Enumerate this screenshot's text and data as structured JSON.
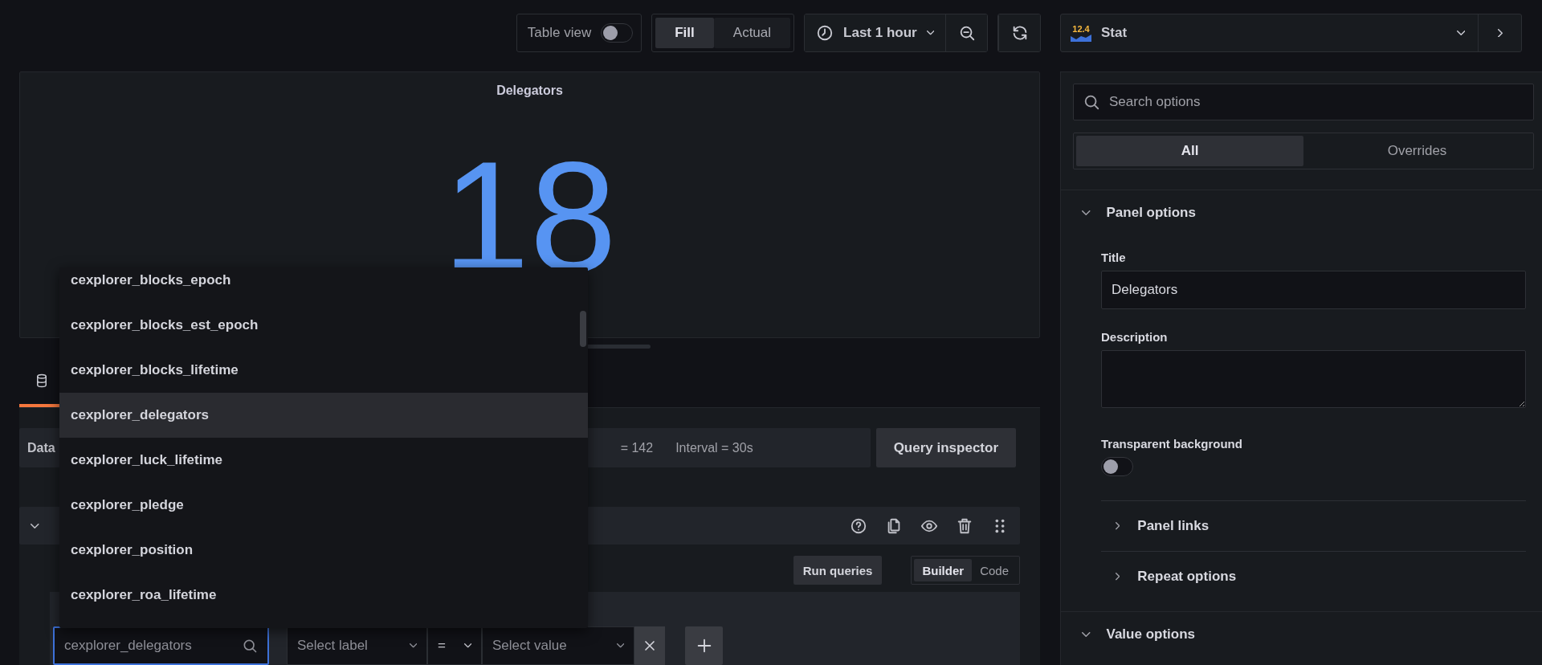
{
  "toolbar": {
    "table_view": {
      "label": "Table view",
      "on": false
    },
    "fill_modes": [
      {
        "label": "Fill",
        "selected": true
      },
      {
        "label": "Actual",
        "selected": false
      }
    ],
    "time_range": "Last 1 hour"
  },
  "visualization": {
    "icon_text": "12.4",
    "name": "Stat"
  },
  "panel": {
    "title": "Delegators",
    "value": "18"
  },
  "query_tab": {
    "selected": true
  },
  "query_info": {
    "data_source": "Data",
    "max_data_points": "= 142",
    "interval": "Interval = 30s"
  },
  "query_inspector": "Query inspector",
  "query": {
    "expanded": true,
    "run_label": "Run queries",
    "modes": [
      {
        "label": "Builder",
        "selected": true
      },
      {
        "label": "Code",
        "selected": false
      }
    ],
    "metric": {
      "placeholder": "cexplorer_delegators",
      "focused": true
    },
    "label_select": {
      "placeholder": "Select label"
    },
    "operator": "=",
    "value_select": {
      "placeholder": "Select value"
    }
  },
  "metric_options": [
    {
      "label": "cexplorer_blocks_epoch",
      "selected": false
    },
    {
      "label": "cexplorer_blocks_est_epoch",
      "selected": false
    },
    {
      "label": "cexplorer_blocks_lifetime",
      "selected": false
    },
    {
      "label": "cexplorer_delegators",
      "selected": true
    },
    {
      "label": "cexplorer_luck_lifetime",
      "selected": false
    },
    {
      "label": "cexplorer_pledge",
      "selected": false
    },
    {
      "label": "cexplorer_position",
      "selected": false
    },
    {
      "label": "cexplorer_roa_lifetime",
      "selected": false
    }
  ],
  "options_pane": {
    "search": {
      "placeholder": "Search options"
    },
    "tabs": [
      {
        "label": "All",
        "selected": true
      },
      {
        "label": "Overrides",
        "selected": false
      }
    ],
    "categories": [
      {
        "title": "Panel options",
        "expanded": true,
        "fields": [
          {
            "kind": "text",
            "label": "Title",
            "value": "Delegators"
          },
          {
            "kind": "textarea",
            "label": "Description"
          },
          {
            "kind": "switch",
            "label": "Transparent background",
            "on": false
          }
        ],
        "subsections": [
          {
            "title": "Panel links",
            "expanded": false
          },
          {
            "title": "Repeat options",
            "expanded": false
          }
        ]
      },
      {
        "title": "Value options",
        "expanded": true
      }
    ]
  }
}
